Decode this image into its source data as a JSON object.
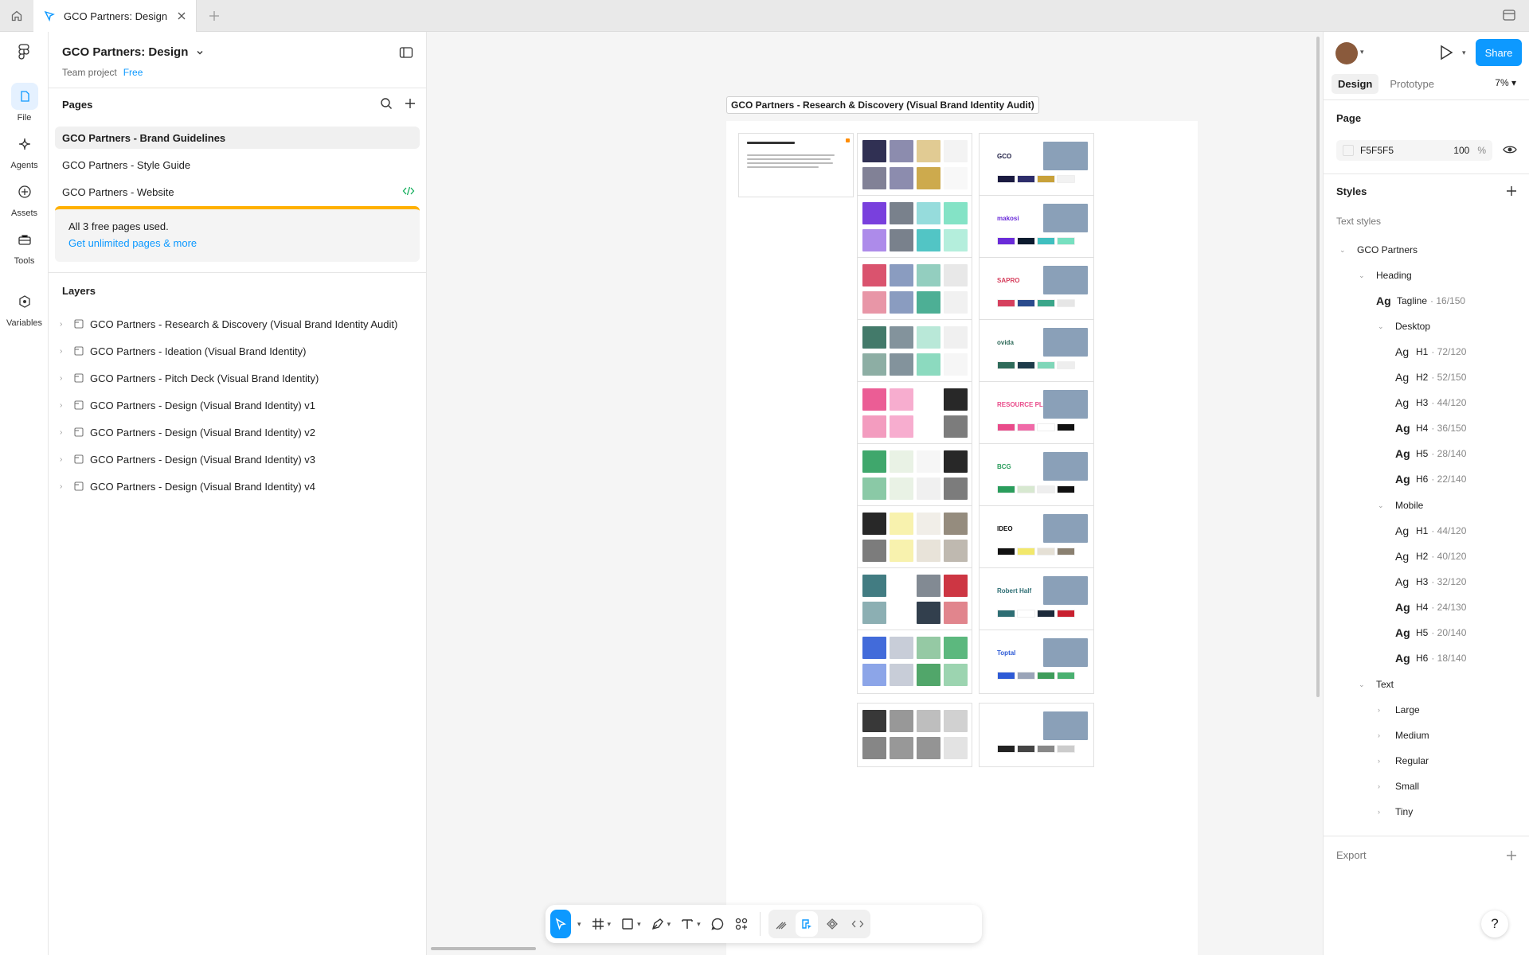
{
  "tab": {
    "title": "GCO Partners: Design"
  },
  "rail": {
    "items": [
      {
        "label": "File"
      },
      {
        "label": "Agents"
      },
      {
        "label": "Assets"
      },
      {
        "label": "Tools"
      },
      {
        "label": "Variables"
      }
    ]
  },
  "file": {
    "title": "GCO Partners: Design",
    "team": "Team project",
    "plan": "Free"
  },
  "pages": {
    "heading": "Pages",
    "items": [
      {
        "label": "GCO Partners - Brand Guidelines"
      },
      {
        "label": "GCO Partners - Style Guide"
      },
      {
        "label": "GCO Partners - Website"
      }
    ],
    "notice": {
      "text": "All 3 free pages used.",
      "link": "Get unlimited pages & more"
    }
  },
  "layers": {
    "heading": "Layers",
    "items": [
      {
        "label": "GCO Partners - Research & Discovery (Visual Brand Identity Audit)"
      },
      {
        "label": "GCO Partners - Ideation (Visual Brand Identity)"
      },
      {
        "label": "GCO Partners - Pitch Deck (Visual Brand Identity)"
      },
      {
        "label": "GCO Partners - Design (Visual Brand Identity) v1"
      },
      {
        "label": "GCO Partners - Design (Visual Brand Identity) v2"
      },
      {
        "label": "GCO Partners - Design (Visual Brand Identity) v3"
      },
      {
        "label": "GCO Partners - Design (Visual Brand Identity) v4"
      }
    ]
  },
  "canvas": {
    "frame_label": "GCO Partners - Research & Discovery (Visual Brand Identity Audit)",
    "thumb_texts": [
      "GCO",
      "makosi",
      "SAPRO",
      "ovida",
      "RESOURCE PLUS",
      "BCG",
      "IDEO",
      "Robert Half",
      "Toptal"
    ]
  },
  "right": {
    "share": "Share",
    "tabs": [
      "Design",
      "Prototype"
    ],
    "zoom": "7%",
    "page_heading": "Page",
    "page_color": "F5F5F5",
    "page_opacity": "100",
    "opacity_unit": "%",
    "styles_heading": "Styles",
    "text_styles_label": "Text styles",
    "group": "GCO Partners",
    "heading_group": "Heading",
    "ag": "Ag",
    "tagline": {
      "name": "Tagline",
      "meta": "· 16/150"
    },
    "desktop": {
      "label": "Desktop",
      "items": [
        {
          "name": "H1",
          "meta": "· 72/120"
        },
        {
          "name": "H2",
          "meta": "· 52/150"
        },
        {
          "name": "H3",
          "meta": "· 44/120"
        },
        {
          "name": "H4",
          "meta": "· 36/150"
        },
        {
          "name": "H5",
          "meta": "· 28/140"
        },
        {
          "name": "H6",
          "meta": "· 22/140"
        }
      ]
    },
    "mobile": {
      "label": "Mobile",
      "items": [
        {
          "name": "H1",
          "meta": "· 44/120"
        },
        {
          "name": "H2",
          "meta": "· 40/120"
        },
        {
          "name": "H3",
          "meta": "· 32/120"
        },
        {
          "name": "H4",
          "meta": "· 24/130"
        },
        {
          "name": "H5",
          "meta": "· 20/140"
        },
        {
          "name": "H6",
          "meta": "· 18/140"
        }
      ]
    },
    "text_group": {
      "label": "Text",
      "items": [
        "Large",
        "Medium",
        "Regular",
        "Small",
        "Tiny"
      ]
    },
    "export": "Export"
  },
  "help": "?",
  "colors": {
    "accent": "#0d99ff",
    "warning": "#ffb000"
  }
}
